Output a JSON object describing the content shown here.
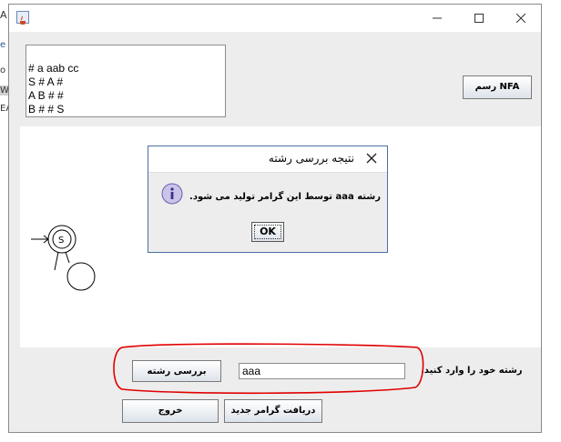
{
  "background_fragments": [
    "A",
    "e",
    "o",
    "W",
    "EA"
  ],
  "window": {
    "icon": "java-cup-icon",
    "controls": [
      "minimize-icon",
      "maximize-icon",
      "close-icon"
    ]
  },
  "grammar": {
    "lines": [
      "# a aab cc",
      "S # A #",
      "A B # #",
      "B # # S"
    ]
  },
  "buttons": {
    "draw_nfa": "رسم NFA",
    "check_string": "بررسی رشته",
    "exit": "خروج",
    "new_grammar": "دریافت گرامر جدید"
  },
  "automaton": {
    "state_label": "S"
  },
  "dialog": {
    "title": "نتیجه بررسی رشته",
    "message": "رشته  aaa توسط این گرامر تولید می شود.",
    "ok_label": "OK",
    "icon": "info-icon"
  },
  "input": {
    "value": "aaa",
    "prompt": "رشته خود را وارد کنید."
  },
  "annotation_color": "#e00000"
}
